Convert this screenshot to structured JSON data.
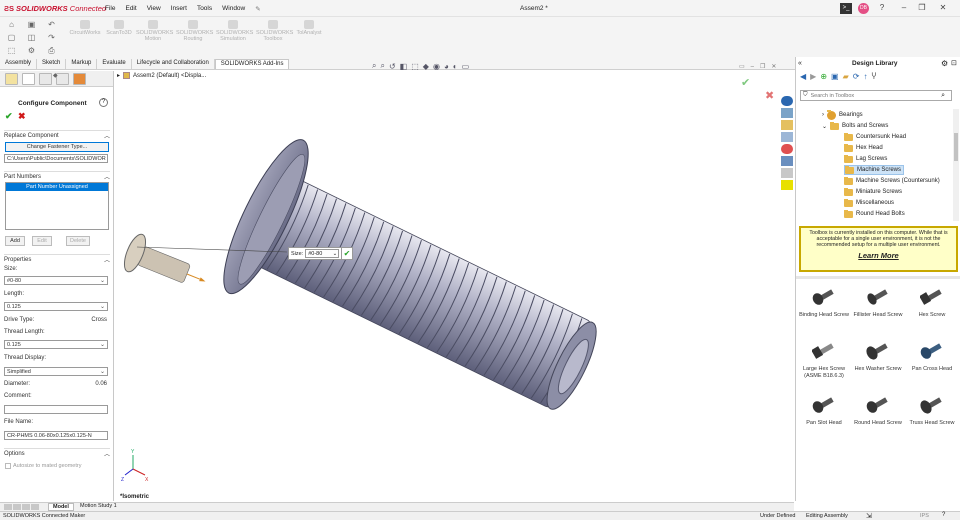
{
  "app": {
    "logo_text": "SOLIDWORKS",
    "logo_suffix": "Connected",
    "doc_title": "Assem2 *",
    "avatar": "DB"
  },
  "menu": [
    "File",
    "Edit",
    "View",
    "Insert",
    "Tools",
    "Window"
  ],
  "addins": [
    "CircuitWorks",
    "ScanTo3D",
    "SOLIDWORKS Motion",
    "SOLIDWORKS Routing",
    "SOLIDWORKS Simulation",
    "SOLIDWORKS Toolbox",
    "TolAnalyst"
  ],
  "command_tabs": [
    "Assembly",
    "Sketch",
    "Markup",
    "Evaluate",
    "Lifecycle and Collaboration",
    "SOLIDWORKS Add-Ins"
  ],
  "active_command_tab": "SOLIDWORKS Add-Ins",
  "panel": {
    "title": "Configure Component",
    "replace_header": "Replace Component",
    "change_fastener_btn": "Change Fastener Type...",
    "path": "C:\\Users\\Public\\Documents\\SOLIDWOR",
    "part_numbers_header": "Part Numbers",
    "part_number_selected": "Part Number Unassigned",
    "add_btn": "Add",
    "edit_btn": "Edit",
    "delete_btn": "Delete",
    "properties_header": "Properties",
    "size_label": "Size:",
    "size_value": "#0-80",
    "length_label": "Length:",
    "length_value": "0.125",
    "drive_type_label": "Drive Type:",
    "drive_type_value": "Cross",
    "thread_length_label": "Thread Length:",
    "thread_length_value": "0.125",
    "thread_display_label": "Thread Display:",
    "thread_display_value": "Simplified",
    "diameter_label": "Diameter:",
    "diameter_value": "0.06",
    "comment_label": "Comment:",
    "comment_value": "",
    "file_name_label": "File Name:",
    "file_name_value": "CR-PHMS 0.06-80x0.125x0.125-N",
    "options_header": "Options",
    "autosize_label": "Autosize to mated geometry"
  },
  "graphics": {
    "tree_node": "Assem2 (Default) <Displa...",
    "size_popup_label": "Size:",
    "size_popup_value": "#0-80",
    "view_label": "*Isometric"
  },
  "design_library": {
    "title": "Design Library",
    "search_placeholder": "Search in Toolbox",
    "tree": [
      {
        "label": "Bearings",
        "level": 1,
        "expanded": false
      },
      {
        "label": "Bolts and Screws",
        "level": 1,
        "expanded": true
      },
      {
        "label": "Countersunk Head",
        "level": 2
      },
      {
        "label": "Hex Head",
        "level": 2
      },
      {
        "label": "Lag Screws",
        "level": 2
      },
      {
        "label": "Machine Screws",
        "level": 2,
        "selected": true
      },
      {
        "label": "Machine Screws (Countersunk)",
        "level": 2
      },
      {
        "label": "Miniature Screws",
        "level": 2
      },
      {
        "label": "Miscellaneous",
        "level": 2
      },
      {
        "label": "Round Head Bolts",
        "level": 2
      }
    ],
    "notice": "Toolbox is currently installed on this computer. While that is acceptable for a single user environment, it is not the recommended setup for a multiple user environment.",
    "learn_more": "Learn More",
    "screws": [
      "Binding Head Screw",
      "Fillister Head Screw",
      "Hex Screw",
      "Large Hex Screw (ASME B18.6.3)",
      "Hex Washer Screw",
      "Pan Cross Head",
      "Pan Slot Head",
      "Round Head Screw",
      "Truss Head Screw"
    ]
  },
  "bottom_tabs": [
    "Model",
    "Motion Study 1"
  ],
  "status": {
    "left": "SOLIDWORKS Connected Maker",
    "under_defined": "Under Defined",
    "editing": "Editing Assembly",
    "units": "IPS"
  },
  "colors": {
    "accent": "#0078d7",
    "brand": "#c8102e",
    "notice_bg": "#ffffc8",
    "notice_border": "#c8a800",
    "check": "#2aa52a",
    "cancel": "#d01818"
  }
}
